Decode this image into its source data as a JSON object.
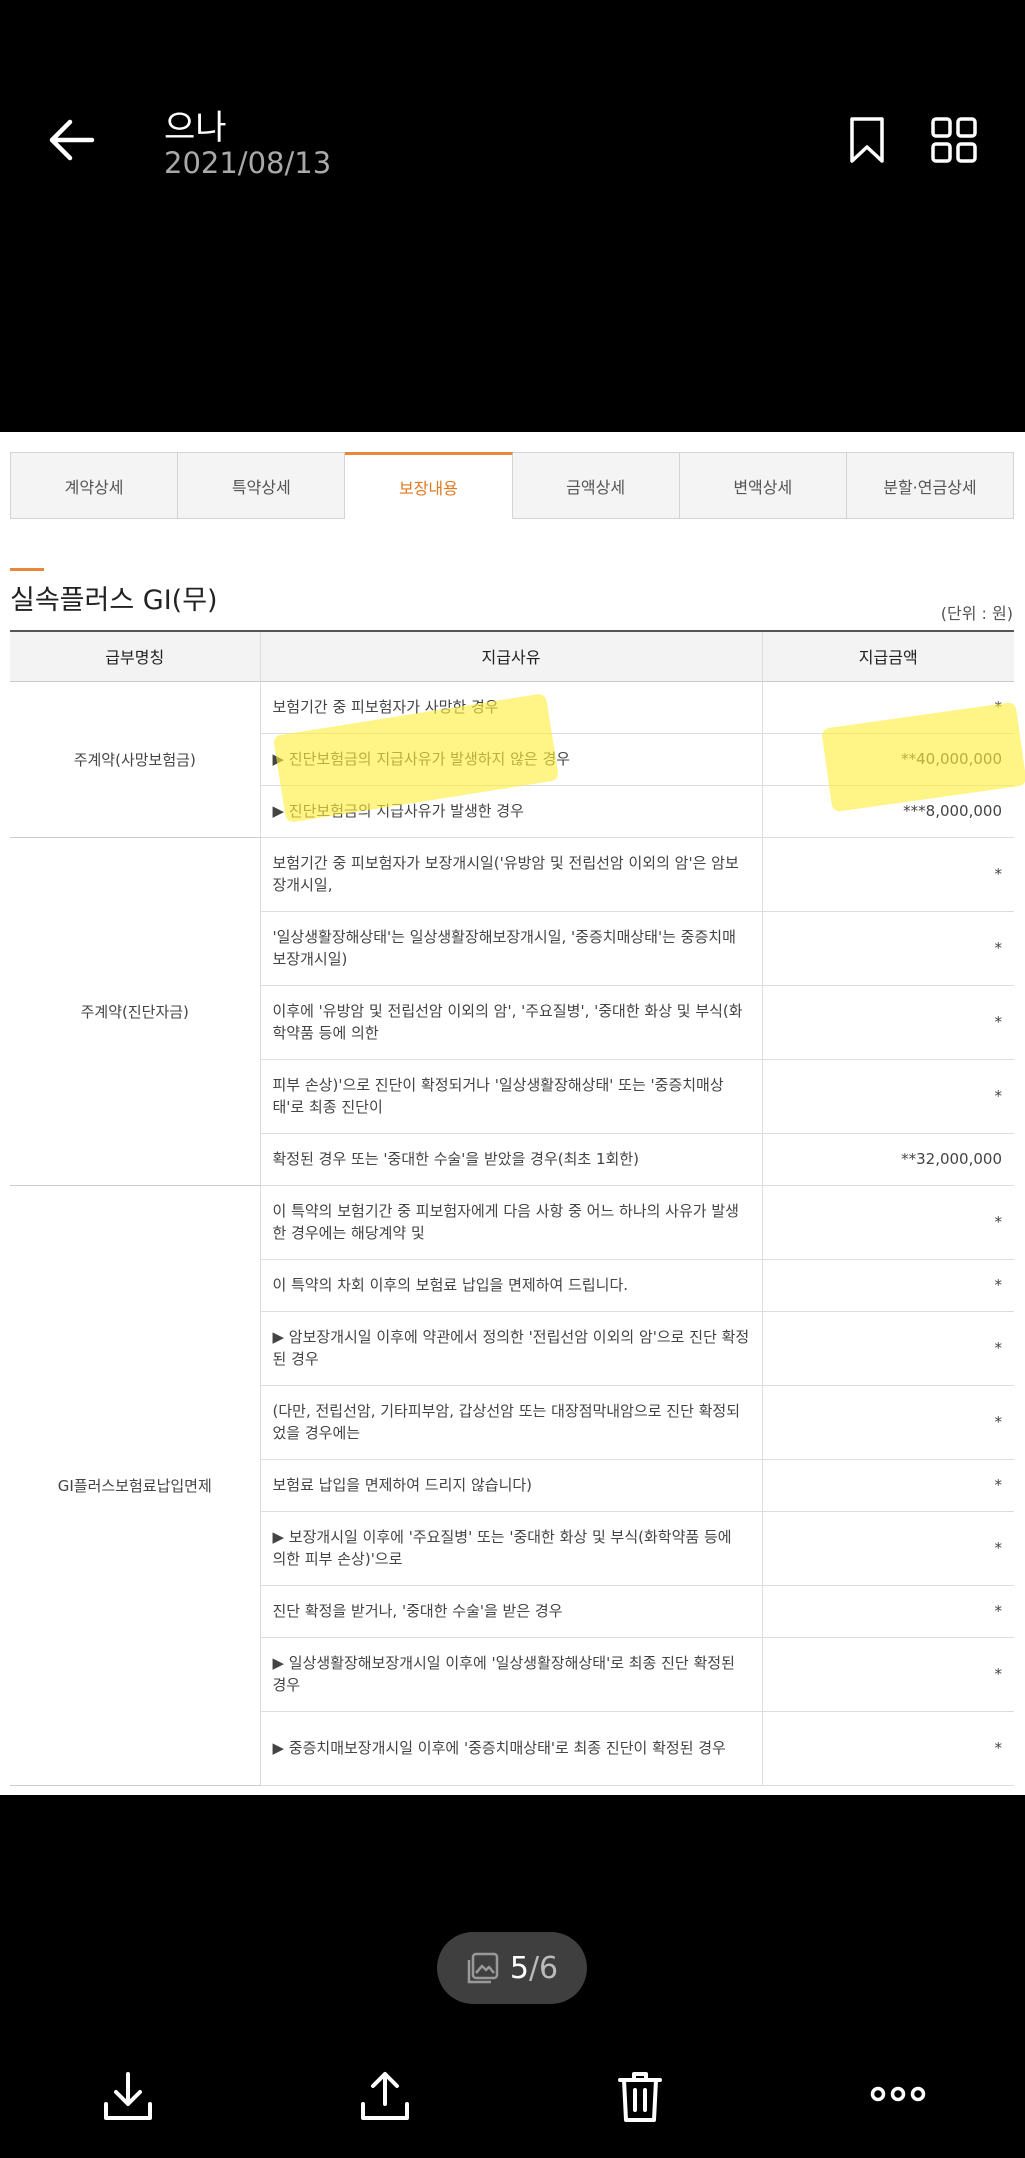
{
  "header": {
    "title": "으나",
    "date": "2021/08/13"
  },
  "tabs": [
    {
      "label": "계약상세",
      "active": false
    },
    {
      "label": "특약상세",
      "active": false
    },
    {
      "label": "보장내용",
      "active": true
    },
    {
      "label": "금액상세",
      "active": false
    },
    {
      "label": "변액상세",
      "active": false
    },
    {
      "label": "분할·연금상세",
      "active": false
    }
  ],
  "section": {
    "title": "실속플러스 GI(무)",
    "unit": "(단위 : 원)"
  },
  "table": {
    "headers": [
      "급부명칭",
      "지급사유",
      "지급금액"
    ],
    "groups": [
      {
        "name": "주계약(사망보험금)",
        "rows": [
          {
            "reason": "보험기간 중 피보험자가 사망한 경우",
            "amount": "*"
          },
          {
            "reason": "▶ 진단보험금의 지급사유가 발생하지 않은 경우",
            "amount": "**40,000,000"
          },
          {
            "reason": "▶ 진단보험금의 지급사유가 발생한 경우",
            "amount": "***8,000,000"
          }
        ]
      },
      {
        "name": "주계약(진단자금)",
        "rows": [
          {
            "reason": "보험기간 중 피보험자가 보장개시일('유방암 및 전립선암 이외의 암'은 암보장개시일,",
            "amount": "*"
          },
          {
            "reason": "'일상생활장해상태'는 일상생활장해보장개시일, '중증치매상태'는 중증치매보장개시일)",
            "amount": "*"
          },
          {
            "reason": "이후에 '유방암 및 전립선암 이외의 암', '주요질병', '중대한 화상 및 부식(화학약품 등에 의한",
            "amount": "*"
          },
          {
            "reason": "피부 손상)'으로 진단이 확정되거나 '일상생활장해상태' 또는 '중증치매상태'로 최종 진단이",
            "amount": "*"
          },
          {
            "reason": "확정된 경우 또는 '중대한 수술'을 받았을 경우(최초 1회한)",
            "amount": "**32,000,000"
          }
        ]
      },
      {
        "name": "GI플러스보험료납입면제",
        "rows": [
          {
            "reason": "이 특약의 보험기간 중 피보험자에게 다음 사항 중 어느 하나의 사유가 발생한 경우에는 해당계약 및",
            "amount": "*"
          },
          {
            "reason": "이 특약의 차회 이후의 보험료 납입을 면제하여 드립니다.",
            "amount": "*"
          },
          {
            "reason": "▶ 암보장개시일 이후에 약관에서 정의한 '전립선암 이외의 암'으로 진단 확정된 경우",
            "amount": "*"
          },
          {
            "reason": "(다만, 전립선암, 기타피부암, 갑상선암 또는 대장점막내암으로 진단 확정되었을 경우에는",
            "amount": "*"
          },
          {
            "reason": "보험료 납입을 면제하여 드리지 않습니다)",
            "amount": "*"
          },
          {
            "reason": "▶ 보장개시일 이후에 '주요질병' 또는 '중대한 화상 및 부식(화학약품 등에 의한 피부 손상)'으로",
            "amount": "*"
          },
          {
            "reason": "진단 확정을 받거나, '중대한 수술'을 받은 경우",
            "amount": "*"
          },
          {
            "reason": "▶ 일상생활장해보장개시일 이후에 '일상생활장해상태'로 최종 진단 확정된 경우",
            "amount": "*"
          },
          {
            "reason": "▶ 중증치매보장개시일 이후에 '중증치매상태'로 최종 진단이 확정된 경우",
            "amount": "*"
          }
        ]
      }
    ]
  },
  "pager": {
    "current": "5",
    "total": "6"
  },
  "icons": {
    "back": "arrow-left-icon",
    "bookmark": "bookmark-icon",
    "grid": "grid-view-icon",
    "download": "download-icon",
    "share": "share-icon",
    "delete": "trash-icon",
    "more": "more-icon",
    "gallery": "image-icon"
  },
  "colors": {
    "accent": "#e8873a",
    "highlight": "#ffee3c"
  }
}
